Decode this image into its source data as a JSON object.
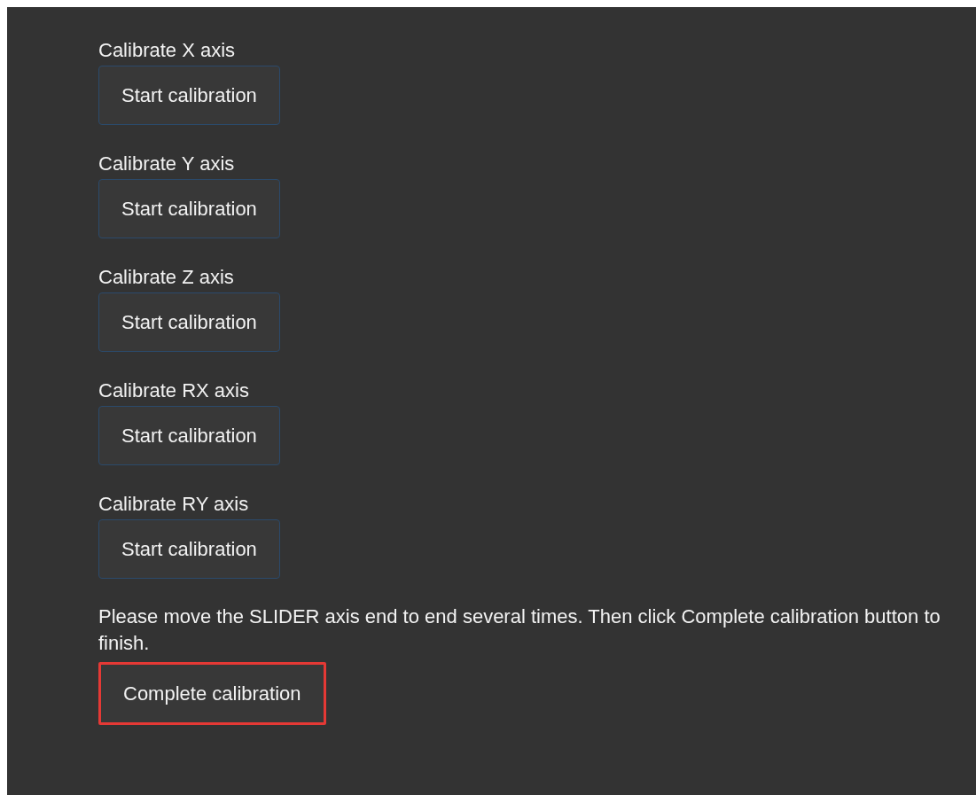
{
  "axes": [
    {
      "label": "Calibrate X axis",
      "button": "Start calibration"
    },
    {
      "label": "Calibrate Y axis",
      "button": "Start calibration"
    },
    {
      "label": "Calibrate Z axis",
      "button": "Start calibration"
    },
    {
      "label": "Calibrate RX axis",
      "button": "Start calibration"
    },
    {
      "label": "Calibrate RY axis",
      "button": "Start calibration"
    }
  ],
  "instruction": "Please move the SLIDER axis end to end several times. Then click Complete calibration button to finish.",
  "complete_button": {
    "label": "Complete calibration",
    "highlighted": true
  }
}
